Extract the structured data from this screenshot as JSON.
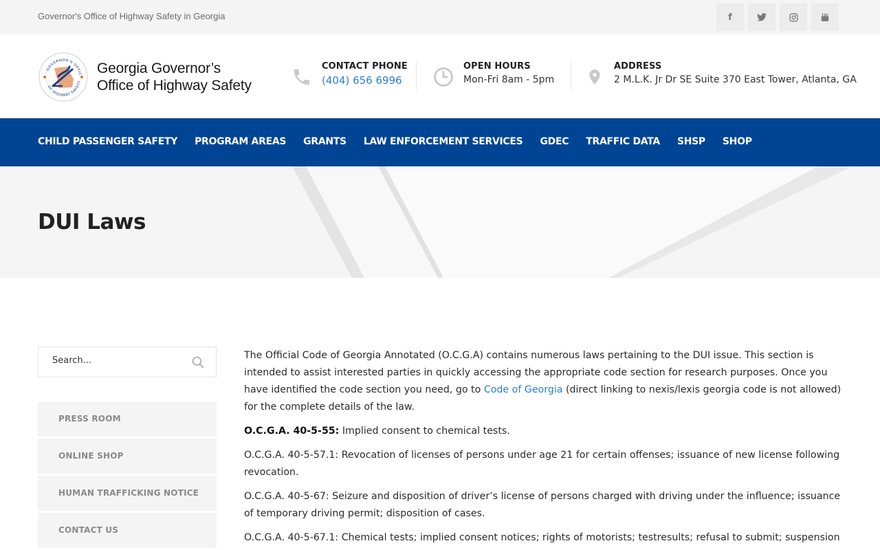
{
  "topbar": {
    "tagline": "Governor's Office of Highway Safety in Georgia",
    "social": [
      {
        "icon": "facebook-icon",
        "glyph": "f"
      },
      {
        "icon": "twitter-icon",
        "glyph": "t"
      },
      {
        "icon": "instagram-icon",
        "glyph": "◎"
      },
      {
        "icon": "youtube-icon",
        "glyph": "▶"
      }
    ]
  },
  "header": {
    "logo_line1": "Georgia Governor’s",
    "logo_line2": "Office of Highway Safety",
    "contact": {
      "label": "CONTACT PHONE",
      "value": "(404) 656 6996"
    },
    "hours": {
      "label": "OPEN HOURS",
      "value": "Mon-Fri 8am - 5pm"
    },
    "address": {
      "label": "ADDRESS",
      "value": "2 M.L.K. Jr Dr SE Suite 370 East Tower, Atlanta, GA"
    }
  },
  "nav": {
    "items": [
      "CHILD PASSENGER SAFETY",
      "PROGRAM AREAS",
      "GRANTS",
      "LAW ENFORCEMENT SERVICES",
      "GDEC",
      "TRAFFIC DATA",
      "SHSP",
      "SHOP"
    ]
  },
  "page": {
    "title": "DUI Laws"
  },
  "sidebar": {
    "search_placeholder": "Search...",
    "menu": [
      "PRESS ROOM",
      "ONLINE SHOP",
      "HUMAN TRAFFICKING NOTICE",
      "CONTACT US"
    ]
  },
  "content": {
    "intro_before_link": "The Official Code of Georgia Annotated (O.C.G.A) contains numerous laws pertaining to the DUI issue. This section is intended to assist interested parties in quickly accessing the appropriate code section for research purposes. Once you have identified the code section you need, go to ",
    "intro_link": "Code of Georgia",
    "intro_after_link": " (direct linking to nexis/lexis georgia code is not allowed) for the complete details of the law.",
    "law1_code": "O.C.G.A. 40-5-55:",
    "law1_text": " Implied consent to chemical tests.",
    "law2": "O.C.G.A. 40-5-57.1: Revocation of licenses of persons under age 21 for certain offenses; issuance of new license following revocation.",
    "law3": "O.C.G.A. 40-5-67: Seizure and disposition of driver’s license of persons charged with driving under the influence; issuance of temporary driving permit; disposition of cases.",
    "law4": "O.C.G.A. 40-5-67.1: Chemical tests; implied consent notices; rights of motorists; testresults; refusal to submit; suspension or"
  },
  "colors": {
    "nav_bg": "#004494",
    "link": "#2a7fd4",
    "band_bg": "#f5f5f5"
  }
}
